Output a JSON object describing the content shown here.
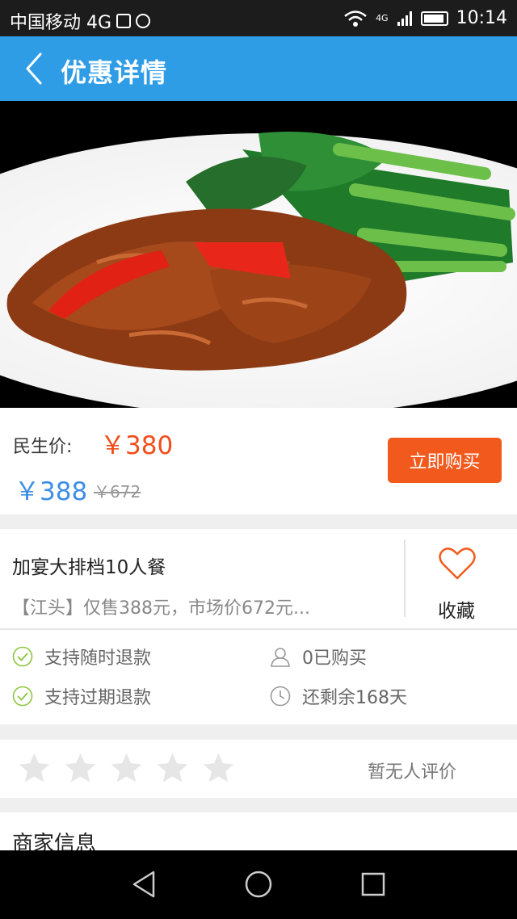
{
  "status_bar": {
    "carrier": "中国移动 4G",
    "time": "10:14",
    "signal_label": "4G"
  },
  "app_bar": {
    "title": "优惠详情",
    "back_icon": "chevron-left-icon"
  },
  "hero": {
    "image_icon": "food-photo"
  },
  "price": {
    "label": "民生价:",
    "value": "￥380",
    "alt_value": "￥388",
    "original": "￥672",
    "buy_label": "立即购买",
    "accent_color": "#f25a1d",
    "blue_color": "#3d8ee4"
  },
  "deal": {
    "title": "加宴大排档10人餐",
    "description": "【江头】仅售388元，市场价672元...",
    "favorite_label": "收藏",
    "features": [
      {
        "text": "支持随时退款",
        "icon": "check-circle-icon"
      },
      {
        "text": "支持过期退款",
        "icon": "check-circle-icon"
      },
      {
        "text": "0已购买",
        "icon": "user-icon"
      },
      {
        "text": "还剩余168天",
        "icon": "clock-icon"
      }
    ]
  },
  "rating": {
    "stars": 0,
    "max_stars": 5,
    "text": "暂无人评价"
  },
  "merchant": {
    "title": "商家信息"
  },
  "nav_bar": {
    "back_icon": "triangle-back-icon",
    "home_icon": "circle-home-icon",
    "recents_icon": "square-recents-icon"
  }
}
